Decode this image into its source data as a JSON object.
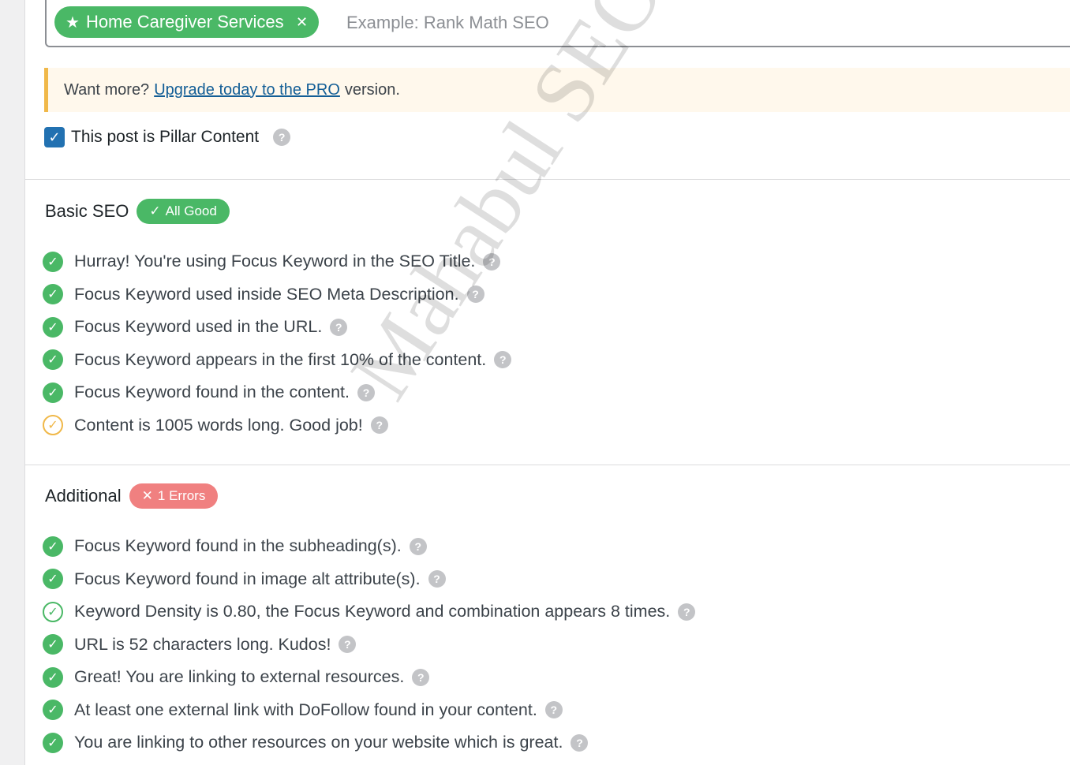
{
  "focus_keyword": {
    "tag_label": "Home Caregiver Services",
    "placeholder": "Example: Rank Math SEO"
  },
  "notice": {
    "prefix": "Want more?",
    "link": "Upgrade today to the PRO",
    "suffix": "version."
  },
  "pillar": {
    "label": "This post is Pillar Content",
    "checked": true
  },
  "basic_seo": {
    "title": "Basic SEO",
    "badge": "All Good",
    "items": [
      "Hurray! You're using Focus Keyword in the SEO Title.",
      "Focus Keyword used inside SEO Meta Description.",
      "Focus Keyword used in the URL.",
      "Focus Keyword appears in the first 10% of the content.",
      "Focus Keyword found in the content.",
      "Content is 1005 words long. Good job!"
    ]
  },
  "additional": {
    "title": "Additional",
    "badge": "1 Errors",
    "items": [
      "Focus Keyword found in the subheading(s).",
      "Focus Keyword found in image alt attribute(s).",
      "Keyword Density is 0.80, the Focus Keyword and combination appears 8 times.",
      "URL is 52 characters long. Kudos!",
      "Great! You are linking to external resources.",
      "At least one external link with DoFollow found in your content.",
      "You are linking to other resources on your website which is great."
    ]
  },
  "watermark": "Mahabul SEO",
  "colors": {
    "success": "#4ab866",
    "warning": "#f0b849",
    "error": "#f08080",
    "link": "#135e96"
  }
}
